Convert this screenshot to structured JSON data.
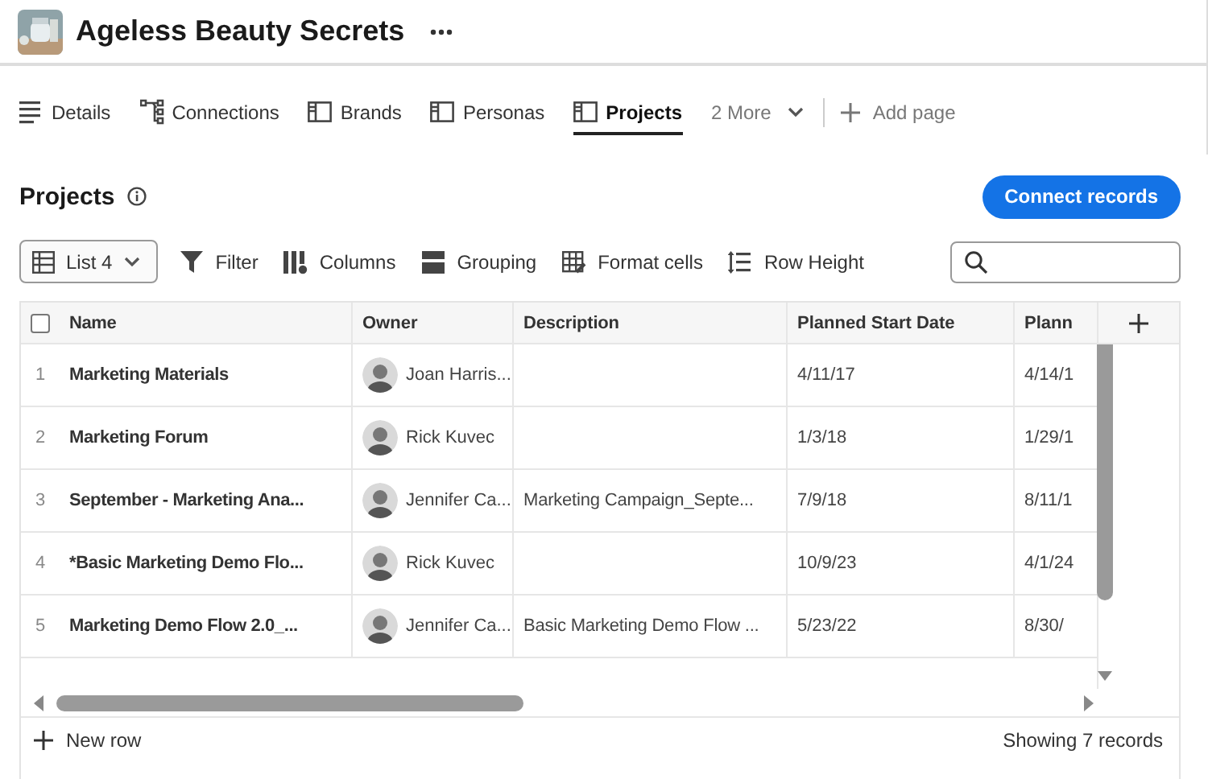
{
  "header": {
    "title": "Ageless Beauty Secrets"
  },
  "tabs": [
    {
      "label": "Details",
      "kind": "lines",
      "selected": false
    },
    {
      "label": "Connections",
      "kind": "connections",
      "selected": false
    },
    {
      "label": "Brands",
      "kind": "page",
      "selected": false
    },
    {
      "label": "Personas",
      "kind": "page",
      "selected": false
    },
    {
      "label": "Projects",
      "kind": "page",
      "selected": true
    }
  ],
  "more_tabs": {
    "label": "2 More"
  },
  "add_page": {
    "label": "Add page"
  },
  "section": {
    "title": "Projects",
    "action": "Connect records"
  },
  "view": {
    "label": "List 4"
  },
  "tools": [
    {
      "label": "Filter",
      "kind": "filter"
    },
    {
      "label": "Columns",
      "kind": "columns"
    },
    {
      "label": "Grouping",
      "kind": "grouping"
    },
    {
      "label": "Format cells",
      "kind": "format"
    },
    {
      "label": "Row Height",
      "kind": "height"
    }
  ],
  "table": {
    "select_all": {
      "checked": false
    },
    "columns": [
      "Name",
      "Owner",
      "Description",
      "Planned Start Date",
      "Plann"
    ],
    "rows": [
      {
        "number": "1",
        "name": "Marketing Materials",
        "owner": "Joan Harris...",
        "description": "",
        "start": "4/11/17",
        "column_5": "4/14/1"
      },
      {
        "number": "2",
        "name": "Marketing Forum",
        "owner": "Rick Kuvec",
        "description": "",
        "start": "1/3/18",
        "column_5": "1/29/1"
      },
      {
        "number": "3",
        "name": "September - Marketing Ana...",
        "owner": "Jennifer Ca...",
        "description": "Marketing Campaign_Septe...",
        "start": "7/9/18",
        "column_5": "8/11/1"
      },
      {
        "number": "4",
        "name": "*Basic Marketing Demo Flo...",
        "owner": "Rick Kuvec",
        "description": "",
        "start": "10/9/23",
        "column_5": "4/1/24"
      },
      {
        "number": "5",
        "name": "Marketing Demo Flow 2.0_...",
        "owner": "Jennifer Ca...",
        "description": "Basic Marketing Demo Flow ...",
        "start": "5/23/22",
        "column_5": "8/30/"
      }
    ]
  },
  "footer": {
    "new_row": "New row",
    "count": "Showing 7 records"
  }
}
